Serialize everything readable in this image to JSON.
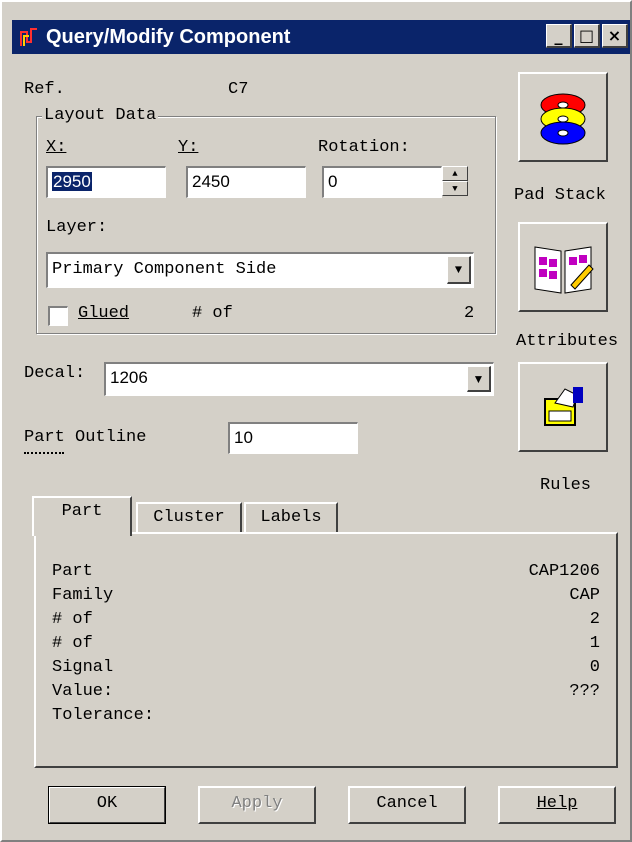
{
  "window": {
    "title": "Query/Modify Component",
    "min_label": "_",
    "max_label": "□",
    "close_label": "×"
  },
  "ref": {
    "label": "Ref.",
    "value": "C7"
  },
  "layout": {
    "group_label": "Layout Data",
    "x_label": "X:",
    "x_value": "2950",
    "y_label": "Y:",
    "y_value": "2450",
    "rotation_label": "Rotation:",
    "rotation_value": "0",
    "layer_label": "Layer:",
    "layer_value": "Primary Component Side",
    "glued_label": "Glued",
    "glued_checked": false,
    "count_label": "# of",
    "count_value": "2"
  },
  "decal": {
    "label": "Decal:",
    "value": "1206"
  },
  "part_outline": {
    "label": "Part Outline",
    "value": "10"
  },
  "side_buttons": {
    "pad_stack": "Pad Stack",
    "attributes": "Attributes",
    "rules": "Rules"
  },
  "tabs": [
    "Part",
    "Cluster",
    "Labels"
  ],
  "part_info": [
    {
      "label": "Part",
      "value": "CAP1206"
    },
    {
      "label": "Family",
      "value": "CAP"
    },
    {
      "label": "# of",
      "value": "2"
    },
    {
      "label": "# of",
      "value": "1"
    },
    {
      "label": "Signal",
      "value": "0"
    },
    {
      "label": "Value:",
      "value": "???"
    },
    {
      "label": "Tolerance:",
      "value": ""
    }
  ],
  "buttons": {
    "ok": "OK",
    "apply": "Apply",
    "cancel": "Cancel",
    "help": "Help"
  },
  "colors": {
    "titlebar": "#0a246a",
    "face": "#d4d0c8",
    "selection": "#0a246a"
  }
}
